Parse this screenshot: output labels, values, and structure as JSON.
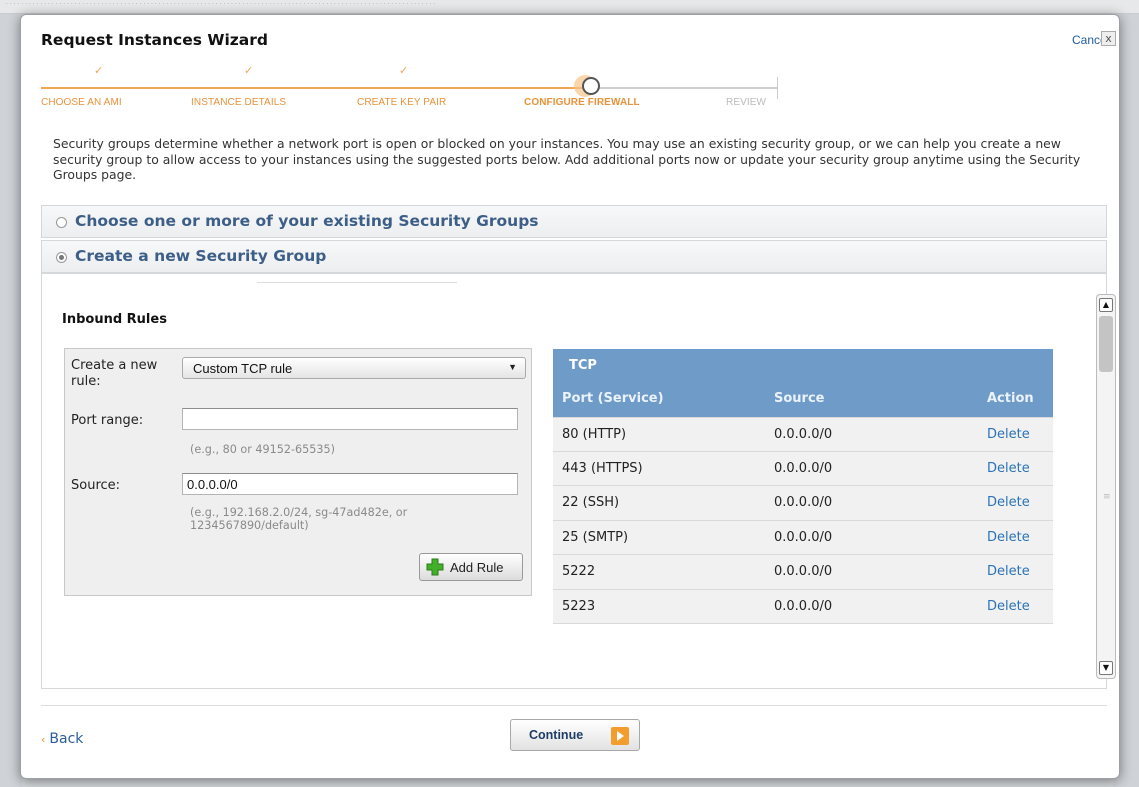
{
  "wizard": {
    "title": "Request Instances Wizard",
    "cancel_label": "Cancel",
    "close_glyph": "x"
  },
  "steps": [
    {
      "label": "CHOOSE AN AMI",
      "state": "done"
    },
    {
      "label": "INSTANCE DETAILS",
      "state": "done"
    },
    {
      "label": "CREATE KEY PAIR",
      "state": "done"
    },
    {
      "label": "CONFIGURE FIREWALL",
      "state": "current"
    },
    {
      "label": "REVIEW",
      "state": "todo"
    }
  ],
  "intro_text": "Security groups determine whether a network port is open or blocked on your instances. You may use an existing security group, or we can help you create a new security group to allow access to your instances using the suggested ports below. Add additional ports now or update your security group anytime using the Security Groups page.",
  "options": {
    "existing": {
      "label": "Choose one or more of your existing Security Groups",
      "selected": false
    },
    "new": {
      "label": "Create a new Security Group",
      "selected": true
    }
  },
  "inbound": {
    "title": "Inbound Rules",
    "form": {
      "rule_label": "Create a new rule:",
      "rule_value": "Custom TCP rule",
      "port_label": "Port range:",
      "port_value": "",
      "port_hint": "(e.g., 80 or 49152-65535)",
      "source_label": "Source:",
      "source_value": "0.0.0.0/0",
      "source_hint_line1": "(e.g., 192.168.2.0/24, sg-47ad482e, or",
      "source_hint_line2": "1234567890/default)",
      "add_button_label": "Add Rule"
    },
    "table": {
      "protocol": "TCP",
      "columns": [
        "Port (Service)",
        "Source",
        "Action"
      ],
      "rows": [
        {
          "port": "80 (HTTP)",
          "source": "0.0.0.0/0",
          "action": "Delete"
        },
        {
          "port": "443 (HTTPS)",
          "source": "0.0.0.0/0",
          "action": "Delete"
        },
        {
          "port": "22 (SSH)",
          "source": "0.0.0.0/0",
          "action": "Delete"
        },
        {
          "port": "25 (SMTP)",
          "source": "0.0.0.0/0",
          "action": "Delete"
        },
        {
          "port": "5222",
          "source": "0.0.0.0/0",
          "action": "Delete"
        },
        {
          "port": "5223",
          "source": "0.0.0.0/0",
          "action": "Delete"
        }
      ]
    }
  },
  "footer": {
    "back_label": "Back",
    "continue_label": "Continue"
  },
  "colors": {
    "accent_orange": "#f0a554",
    "table_header": "#6f9bc8",
    "link_blue": "#2b73b7",
    "heading_blue": "#3c5e87"
  },
  "icons": {
    "step_done": "check-icon",
    "add_rule": "plus-icon",
    "continue": "arrow-right-icon",
    "select": "chevron-down-icon"
  }
}
